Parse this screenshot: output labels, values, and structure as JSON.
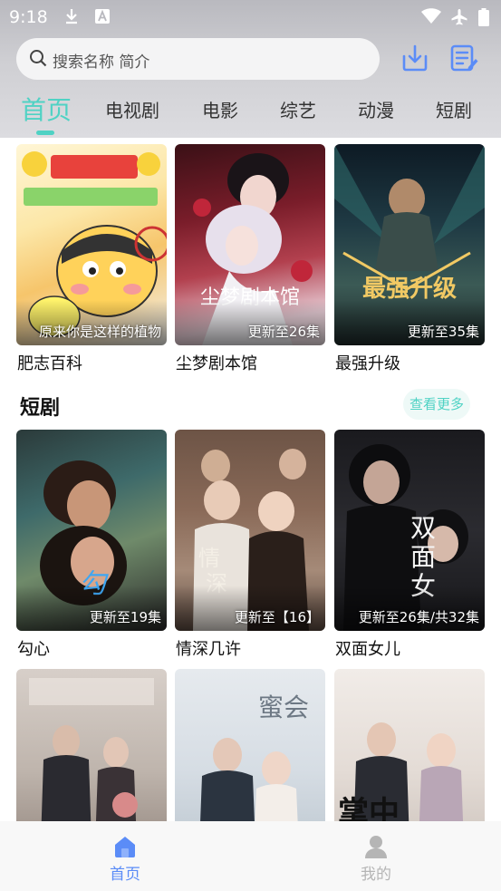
{
  "status_bar": {
    "time": "9:18",
    "icons": [
      "download-icon",
      "a-letter-icon",
      "wifi-icon",
      "airplane-mode-icon",
      "battery-icon"
    ]
  },
  "search": {
    "placeholder": "搜索名称 简介"
  },
  "header_icons": [
    "download-icon",
    "history-list-icon"
  ],
  "colors": {
    "accent": "#4fd2c4",
    "nav_active": "#5b8cf7",
    "nav_inactive": "#b5b5b5"
  },
  "tabs": [
    {
      "label": "首页",
      "active": true
    },
    {
      "label": "电视剧"
    },
    {
      "label": "电影"
    },
    {
      "label": "综艺"
    },
    {
      "label": "动漫"
    },
    {
      "label": "短剧"
    }
  ],
  "top_row": [
    {
      "title": "肥志百科",
      "badge": "原来你是这样的植物"
    },
    {
      "title": "尘梦剧本馆",
      "badge": "更新至26集"
    },
    {
      "title": "最强升级",
      "badge": "更新至35集"
    }
  ],
  "short_drama": {
    "title": "短剧",
    "more_label": "查看更多",
    "items": [
      {
        "title": "勾心",
        "badge": "更新至19集"
      },
      {
        "title": "情深几许",
        "badge": "更新至【16】"
      },
      {
        "title": "双面女儿",
        "badge": "更新至26集/共32集"
      }
    ]
  },
  "third_row": [
    {
      "title": "",
      "badge": ""
    },
    {
      "title": "",
      "badge": ""
    },
    {
      "title": "",
      "badge": ""
    }
  ],
  "bottom_nav": [
    {
      "label": "首页",
      "icon": "home-icon",
      "active": true
    },
    {
      "label": "我的",
      "icon": "profile-icon",
      "active": false
    }
  ]
}
